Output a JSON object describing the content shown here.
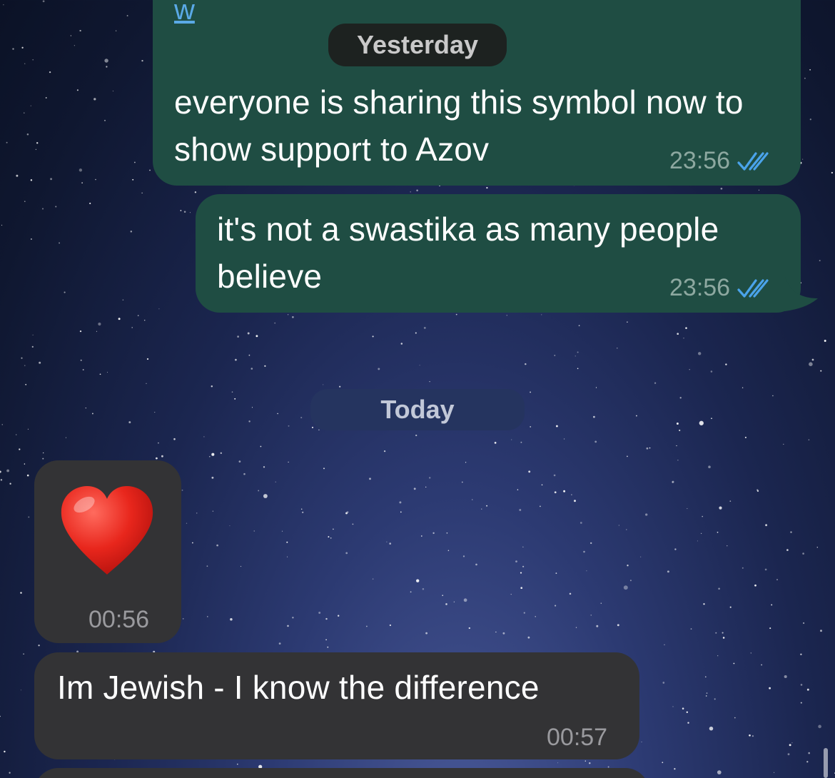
{
  "conversation": {
    "top_link_fragment": "w",
    "date_yesterday": "Yesterday",
    "date_today": "Today",
    "messages": [
      {
        "direction": "outgoing",
        "text": "everyone is sharing this symbol now to show support to Azov",
        "time": "23:56",
        "status": "read"
      },
      {
        "direction": "outgoing",
        "text": "it's not a swastika as many people believe",
        "time": "23:56",
        "status": "read"
      },
      {
        "direction": "incoming",
        "text": "❤️",
        "time": "00:56"
      },
      {
        "direction": "incoming",
        "text": "Im Jewish - I know the difference",
        "time": "00:57"
      }
    ]
  },
  "colors": {
    "outgoing_bubble": "#1f4d43",
    "incoming_bubble": "#333335",
    "read_ticks": "#4aa3ea",
    "yesterday_pill": "#1d2220",
    "today_pill": "#25345f"
  },
  "icons": {
    "read_status": "double-check-icon",
    "reaction": "heart-emoji"
  }
}
